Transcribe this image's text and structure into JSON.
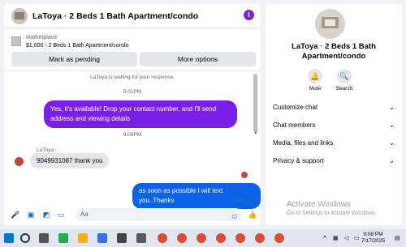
{
  "chat": {
    "title": "LaToya · 2 Beds 1 Bath Apartment/condo",
    "info_icon": "info-icon"
  },
  "marketplace": {
    "label": "Marketplace",
    "listing": "$1,000 - 2 Beds 1 Bath Apartment/condo",
    "mark_pending": "Mark as pending",
    "more_options": "More options"
  },
  "messages": {
    "waiting": "LaToya is waiting for your response.",
    "time1": "5:01PM",
    "outgoing1": "Yes, it's available! Drop your contact number, and I'll send address and viewing details",
    "time2": "9:06PM",
    "sender": "LaToya",
    "incoming1": "9049931087 thank you",
    "outgoing2": "as soon as possible I will text you..Thanks",
    "status": "Sent"
  },
  "composer": {
    "placeholder": "Aa"
  },
  "sidebar": {
    "title": "LaToya · 2 Beds 1 Bath Apartment/condo",
    "mute": "Mute",
    "search": "Search",
    "menu": [
      "Customize chat",
      "Chat members",
      "Media, files and links",
      "Privacy & support"
    ]
  },
  "watermark": {
    "title": "Activate Windows",
    "subtitle": "Go to Settings to activate Windows."
  },
  "taskbar": {
    "time": "9:08 PM",
    "date": "7/17/2025"
  },
  "colors": {
    "accent_purple": "#7a1fe8",
    "accent_blue": "#0a62e6"
  }
}
